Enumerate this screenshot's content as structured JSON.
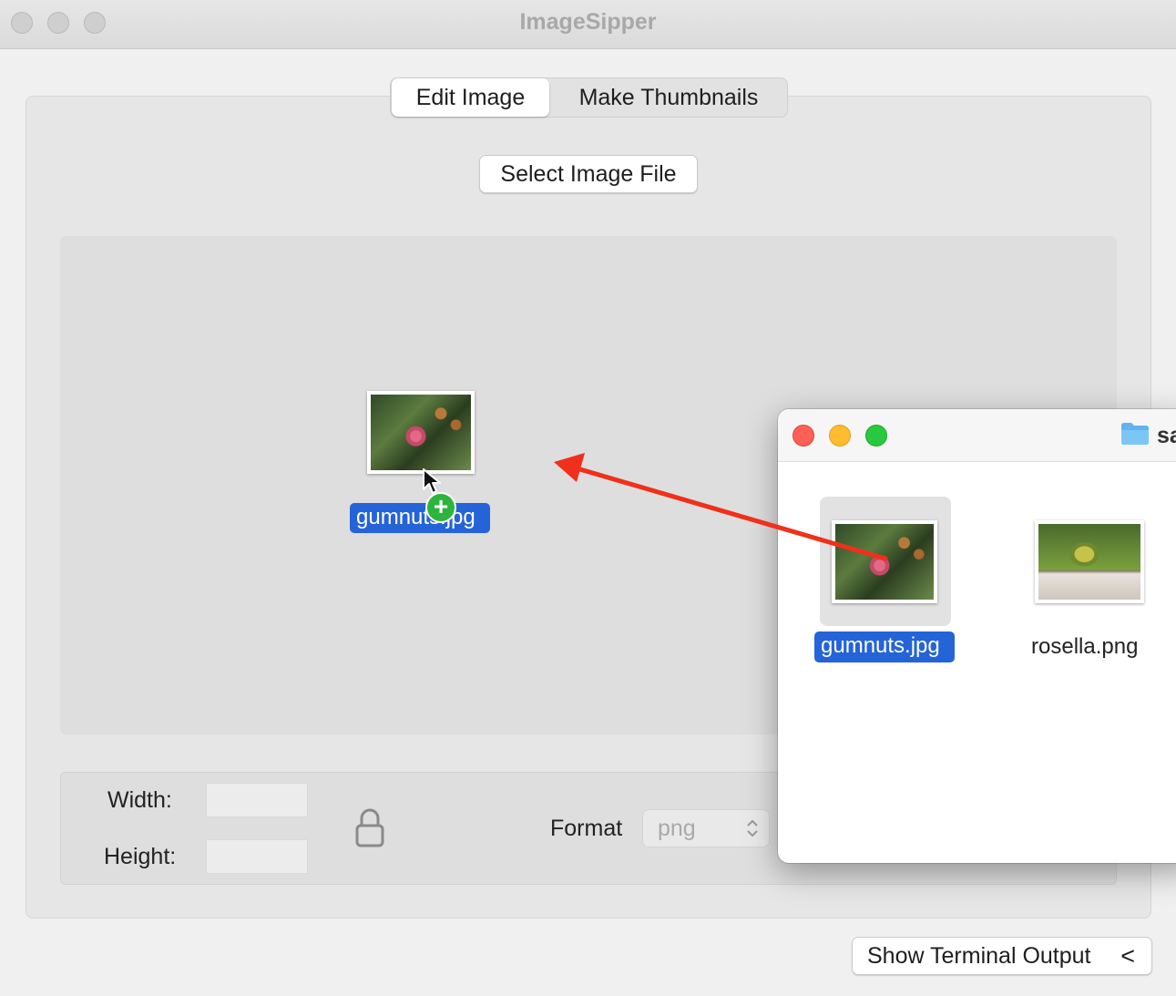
{
  "window": {
    "title": "ImageSipper"
  },
  "tabs": [
    {
      "label": "Edit Image",
      "active": true
    },
    {
      "label": "Make Thumbnails",
      "active": false
    }
  ],
  "select_button": {
    "label": "Select Image File"
  },
  "drag": {
    "file_label": "gumnuts.jpg",
    "badge": "+"
  },
  "fields": {
    "width_label": "Width:",
    "height_label": "Height:",
    "width_value": "",
    "height_value": "",
    "format_label": "Format",
    "format_value": "png"
  },
  "terminal_button": {
    "label": "Show Terminal Output",
    "chevron": "<"
  },
  "finder": {
    "title": "sa",
    "files": [
      {
        "name": "gumnuts.jpg",
        "selected": true
      },
      {
        "name": "rosella.png",
        "selected": false
      }
    ]
  },
  "colors": {
    "accent": "#2563d9",
    "arrow": "#f0301a",
    "add_badge": "#2db43c"
  }
}
